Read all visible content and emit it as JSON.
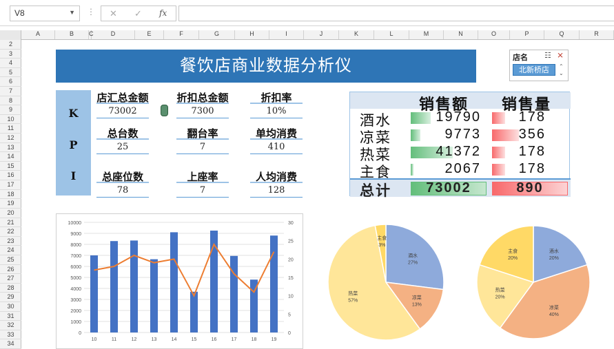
{
  "formula_bar": {
    "cell_ref": "V8",
    "cancel": "✕",
    "confirm": "✓",
    "fx": "fx",
    "value": ""
  },
  "columns": [
    "A",
    "B",
    "C",
    "D",
    "E",
    "F",
    "G",
    "H",
    "I",
    "J",
    "K",
    "L",
    "M",
    "N",
    "O",
    "P",
    "Q",
    "R"
  ],
  "rows": [
    "2",
    "3",
    "4",
    "5",
    "6",
    "7",
    "8",
    "9",
    "10",
    "11",
    "12",
    "13",
    "14",
    "15",
    "16",
    "17",
    "18",
    "19",
    "20",
    "21",
    "22",
    "23",
    "24",
    "25",
    "26",
    "27",
    "28",
    "29",
    "30",
    "31",
    "32",
    "33",
    "34"
  ],
  "title": "餐饮店商业数据分析仪",
  "slicer": {
    "header": "店名",
    "selected": "北新桥店"
  },
  "kpi": {
    "side_letters": [
      "K",
      "P",
      "I"
    ],
    "cells": [
      {
        "label": "店汇总金额",
        "value": "73002"
      },
      {
        "label": "折扣总金额",
        "value": "7300"
      },
      {
        "label": "折扣率",
        "value": "10%"
      },
      {
        "label": "总台数",
        "value": "25"
      },
      {
        "label": "翻台率",
        "value": "7"
      },
      {
        "label": "单均消费",
        "value": "410"
      },
      {
        "label": "总座位数",
        "value": "78"
      },
      {
        "label": "上座率",
        "value": "7"
      },
      {
        "label": "人均消费",
        "value": "128"
      }
    ]
  },
  "sales_table": {
    "headers": [
      "销售额",
      "销售量"
    ],
    "rows": [
      {
        "name": "酒水",
        "amount": 19790,
        "qty": 178
      },
      {
        "name": "凉菜",
        "amount": 9773,
        "qty": 356
      },
      {
        "name": "热菜",
        "amount": 41372,
        "qty": 178
      },
      {
        "name": "主食",
        "amount": 2067,
        "qty": 178
      }
    ],
    "total_label": "总计",
    "total_amount": "73002",
    "total_qty": "890",
    "colors": {
      "amount_bar": "#63be7b",
      "qty_bar": "#f8696b"
    }
  },
  "chart_data": [
    {
      "type": "bar",
      "categories": [
        "10",
        "11",
        "12",
        "13",
        "14",
        "15",
        "16",
        "17",
        "18",
        "19"
      ],
      "series": [
        {
          "values": [
            7000,
            8300,
            8350,
            6650,
            9100,
            3700,
            9250,
            6950,
            4800,
            8800
          ],
          "color": "#4472c4"
        },
        {
          "values": [
            17,
            18,
            21,
            19,
            20,
            10,
            24,
            16,
            11,
            22
          ],
          "color": "#ed7d31",
          "render": "line",
          "axis": "right"
        }
      ],
      "ylim": [
        0,
        10000
      ],
      "y2lim": [
        0,
        30
      ],
      "yticks": [
        "0",
        "1000",
        "2000",
        "3000",
        "4000",
        "5000",
        "6000",
        "7000",
        "8000",
        "9000",
        "10000"
      ],
      "y2ticks": [
        "0",
        "5",
        "10",
        "15",
        "20",
        "25",
        "30"
      ],
      "grid": true
    },
    {
      "type": "pie",
      "slices": [
        {
          "label": "酒水",
          "pct_label": "27%",
          "value": 27,
          "color": "#8eaadb"
        },
        {
          "label": "凉菜",
          "pct_label": "13%",
          "value": 13,
          "color": "#f4b183"
        },
        {
          "label": "热菜",
          "pct_label": "57%",
          "value": 57,
          "color": "#ffe699"
        },
        {
          "label": "主食",
          "pct_label": "3%",
          "value": 3,
          "color": "#ffd966"
        }
      ]
    },
    {
      "type": "pie",
      "slices": [
        {
          "label": "酒水",
          "pct_label": "20%",
          "value": 20,
          "color": "#8eaadb"
        },
        {
          "label": "凉菜",
          "pct_label": "40%",
          "value": 40,
          "color": "#f4b183"
        },
        {
          "label": "热菜",
          "pct_label": "20%",
          "value": 20,
          "color": "#ffe699"
        },
        {
          "label": "主食",
          "pct_label": "20%",
          "value": 20,
          "color": "#ffd966"
        }
      ]
    }
  ]
}
